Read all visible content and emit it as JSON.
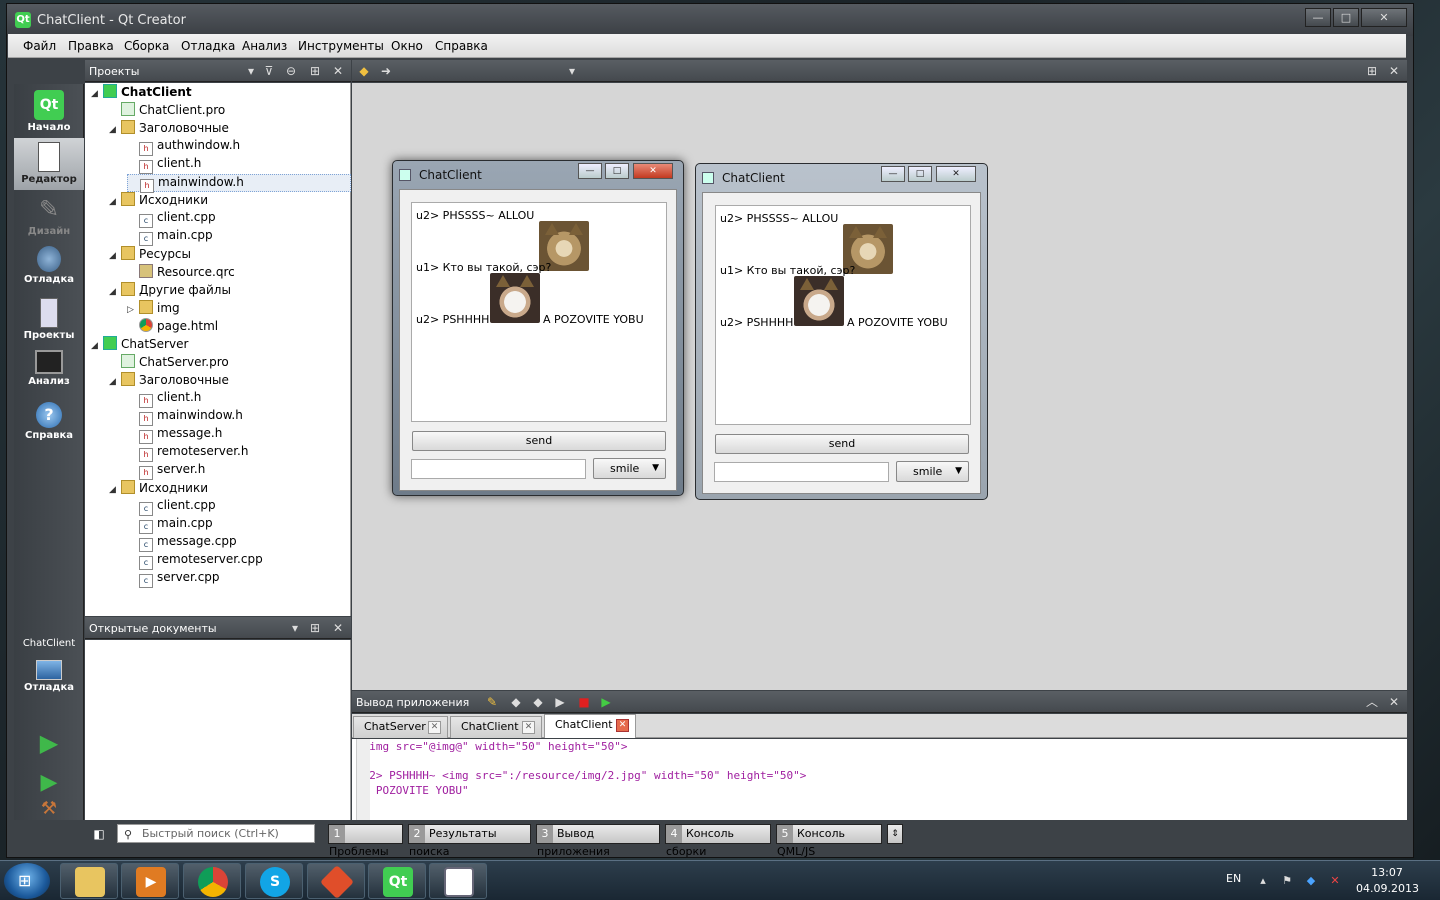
{
  "window": {
    "title": "ChatClient - Qt Creator",
    "app_icon": "Qt",
    "minimize": "—",
    "maximize": "□",
    "close": "✕"
  },
  "menu": [
    "Файл",
    "Правка",
    "Сборка",
    "Отладка",
    "Анализ",
    "Инструменты",
    "Окно",
    "Справка"
  ],
  "modes": {
    "welcome": "Начало",
    "editor": "Редактор",
    "design": "Дизайн",
    "debug": "Отладка",
    "projects": "Проекты",
    "analyze": "Анализ",
    "help": "Справка",
    "target_project": "ChatClient",
    "target_mode": "Отладка"
  },
  "projects_panel": {
    "title": "Проекты",
    "tree": [
      {
        "label": "ChatClient",
        "type": "qt",
        "arrow": "◢",
        "bold": true
      },
      {
        "label": "ChatClient.pro",
        "type": "pro",
        "arrow": ""
      },
      {
        "label": "Заголовочные",
        "type": "folder",
        "arrow": "◢"
      },
      {
        "label": "authwindow.h",
        "type": "h",
        "arrow": ""
      },
      {
        "label": "client.h",
        "type": "h",
        "arrow": ""
      },
      {
        "label": "mainwindow.h",
        "type": "h",
        "arrow": "",
        "selected": true
      },
      {
        "label": "Исходники",
        "type": "folder",
        "arrow": "◢"
      },
      {
        "label": "client.cpp",
        "type": "cpp",
        "arrow": ""
      },
      {
        "label": "main.cpp",
        "type": "cpp",
        "arrow": ""
      },
      {
        "label": "Ресурсы",
        "type": "folder",
        "arrow": "◢"
      },
      {
        "label": "Resource.qrc",
        "type": "qrc",
        "arrow": ""
      },
      {
        "label": "Другие файлы",
        "type": "folder",
        "arrow": "◢"
      },
      {
        "label": "img",
        "type": "folder",
        "arrow": "▷"
      },
      {
        "label": "page.html",
        "type": "web",
        "arrow": ""
      },
      {
        "label": "ChatServer",
        "type": "qt",
        "arrow": "◢"
      },
      {
        "label": "ChatServer.pro",
        "type": "pro",
        "arrow": ""
      },
      {
        "label": "Заголовочные",
        "type": "folder",
        "arrow": "◢"
      },
      {
        "label": "client.h",
        "type": "h",
        "arrow": ""
      },
      {
        "label": "mainwindow.h",
        "type": "h",
        "arrow": ""
      },
      {
        "label": "message.h",
        "type": "h",
        "arrow": ""
      },
      {
        "label": "remoteserver.h",
        "type": "h",
        "arrow": ""
      },
      {
        "label": "server.h",
        "type": "h",
        "arrow": ""
      },
      {
        "label": "Исходники",
        "type": "folder",
        "arrow": "◢"
      },
      {
        "label": "client.cpp",
        "type": "cpp",
        "arrow": ""
      },
      {
        "label": "main.cpp",
        "type": "cpp",
        "arrow": ""
      },
      {
        "label": "message.cpp",
        "type": "cpp",
        "arrow": ""
      },
      {
        "label": "remoteserver.cpp",
        "type": "cpp",
        "arrow": ""
      },
      {
        "label": "server.cpp",
        "type": "cpp",
        "arrow": ""
      }
    ]
  },
  "open_docs": {
    "title": "Открытые документы"
  },
  "chat_window": {
    "title": "ChatClient",
    "line1": "u2> PHSSSS~ ALLOU",
    "line2": "u1> Кто вы такой, сэр?",
    "line3_prefix": "u2> PSHHHH~",
    "line3_suffix": "A POZOVITE YOBU",
    "send": "send",
    "smile": "smile"
  },
  "output": {
    "title": "Вывод приложения",
    "tabs": [
      "ChatServer",
      "ChatClient",
      "ChatClient"
    ],
    "active_tab": 2,
    "lines": [
      "\"<img src=\"@img@\" width=\"50\" height=\"50\">",
      "\"",
      "\"u2> PSHHHH~ <img src=\":/resource/img/2.jpg\" width=\"50\" height=\"50\">",
      " A POZOVITE YOBU\""
    ]
  },
  "status_bar": {
    "locator_placeholder": "Быстрый поиск (Ctrl+K)",
    "panes": [
      {
        "n": "1",
        "label": "Проблемы"
      },
      {
        "n": "2",
        "label": "Результаты поиска"
      },
      {
        "n": "3",
        "label": "Вывод приложения"
      },
      {
        "n": "4",
        "label": "Консоль сборки"
      },
      {
        "n": "5",
        "label": "Консоль QML/JS"
      }
    ]
  },
  "taskbar": {
    "lang": "EN",
    "time": "13:07",
    "date": "04.09.2013"
  }
}
